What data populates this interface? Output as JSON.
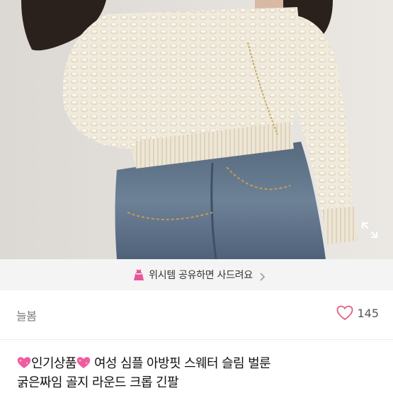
{
  "photo": {
    "alt_icon": "expand-icon"
  },
  "wish_banner": {
    "icon": "dress-icon",
    "text": "위시템 공유하면 사드려요",
    "chevron_icon": "chevron-right-icon"
  },
  "seller": {
    "name": "늘봄"
  },
  "likes": {
    "icon": "heart-outline-icon",
    "count": "145",
    "color": "#e0607e"
  },
  "product": {
    "badge_icon": "sparkling-heart-icon",
    "badge_text": "인기상품",
    "title_line1": "여성 심플 아방핏 스웨터 슬림 벌룬",
    "title_line2": "굵은짜임 골지 라운드 크롭 긴팔"
  },
  "colors": {
    "accent_pink": "#e9559a",
    "banner_bg": "#f4f4f5"
  }
}
